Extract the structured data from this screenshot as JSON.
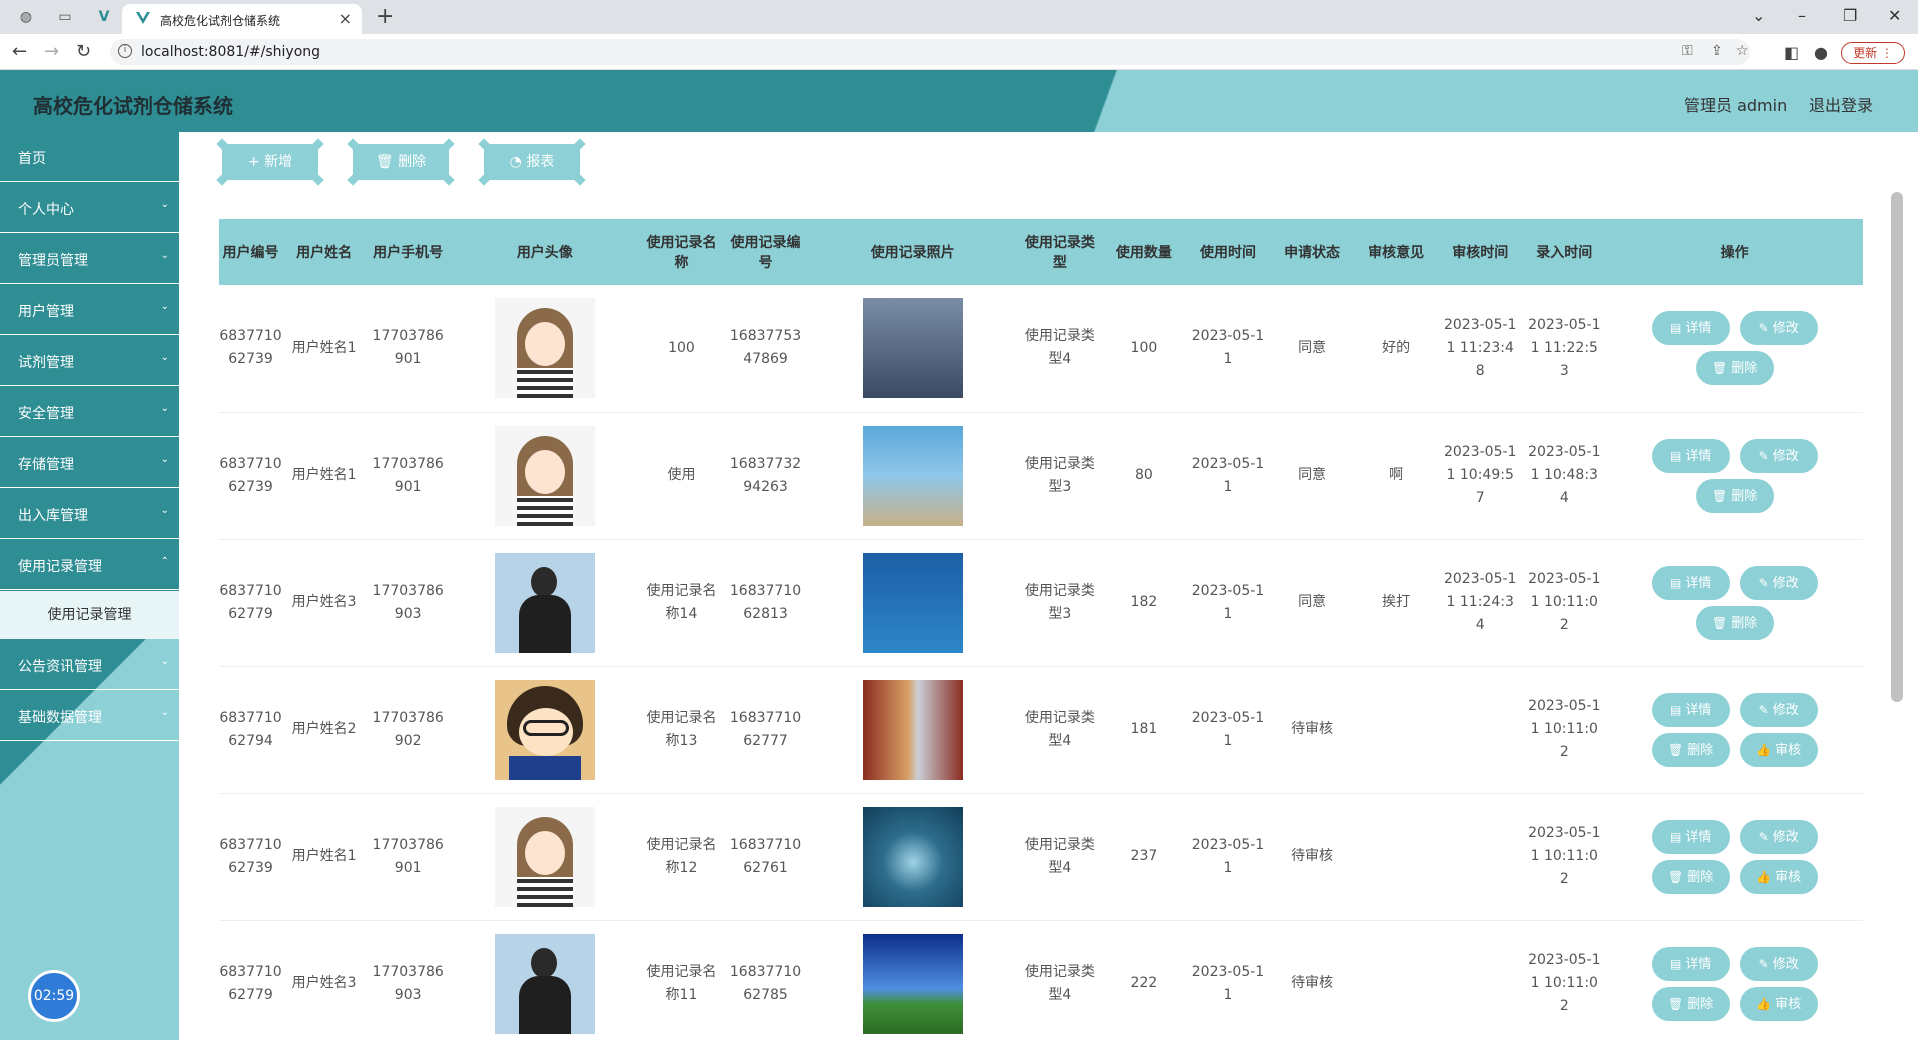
{
  "browser": {
    "tab_title": "高校危化试剂仓储系统",
    "url": "localhost:8081/#/shiyong",
    "update_label": "更新"
  },
  "header": {
    "title": "高校危化试剂仓储系统",
    "user": "管理员 admin",
    "logout": "退出登录"
  },
  "sidebar": {
    "items": [
      {
        "label": "首页"
      },
      {
        "label": "个人中心"
      },
      {
        "label": "管理员管理"
      },
      {
        "label": "用户管理"
      },
      {
        "label": "试剂管理"
      },
      {
        "label": "安全管理"
      },
      {
        "label": "存储管理"
      },
      {
        "label": "出入库管理"
      },
      {
        "label": "使用记录管理"
      },
      {
        "label": "公告资讯管理"
      },
      {
        "label": "基础数据管理"
      }
    ],
    "sub_item": "使用记录管理",
    "timer": "02:59"
  },
  "toolbar": {
    "add": "新增",
    "delete": "删除",
    "report": "报表"
  },
  "table": {
    "headers": [
      "用户编号",
      "用户姓名",
      "用户手机号",
      "用户头像",
      "使用记录名称",
      "使用记录编号",
      "使用记录照片",
      "使用记录类型",
      "使用数量",
      "使用时间",
      "申请状态",
      "审核意见",
      "审核时间",
      "录入时间",
      "操作"
    ],
    "op_labels": {
      "detail": "详情",
      "edit": "修改",
      "delete": "删除",
      "review": "审核"
    },
    "rows": [
      {
        "user_no": "683771062739",
        "user_name": "用户姓名1",
        "phone": "17703786901",
        "name": "100",
        "no": "1683775347869",
        "type": "使用记录类型4",
        "qty": "100",
        "use_time": "2023-05-11",
        "status": "同意",
        "opinion": "好的",
        "review_time": "2023-05-11 11:23:48",
        "entry_time": "2023-05-11 11:22:53"
      },
      {
        "user_no": "683771062739",
        "user_name": "用户姓名1",
        "phone": "17703786901",
        "name": "使用",
        "no": "1683773294263",
        "type": "使用记录类型3",
        "qty": "80",
        "use_time": "2023-05-11",
        "status": "同意",
        "opinion": "啊",
        "review_time": "2023-05-11 10:49:57",
        "entry_time": "2023-05-11 10:48:34"
      },
      {
        "user_no": "683771062779",
        "user_name": "用户姓名3",
        "phone": "17703786903",
        "name": "使用记录名称14",
        "no": "1683771062813",
        "type": "使用记录类型3",
        "qty": "182",
        "use_time": "2023-05-11",
        "status": "同意",
        "opinion": "挨打",
        "review_time": "2023-05-11 11:24:34",
        "entry_time": "2023-05-11 10:11:02"
      },
      {
        "user_no": "683771062794",
        "user_name": "用户姓名2",
        "phone": "17703786902",
        "name": "使用记录名称13",
        "no": "1683771062777",
        "type": "使用记录类型4",
        "qty": "181",
        "use_time": "2023-05-11",
        "status": "待审核",
        "opinion": "",
        "review_time": "",
        "entry_time": "2023-05-11 10:11:02"
      },
      {
        "user_no": "683771062739",
        "user_name": "用户姓名1",
        "phone": "17703786901",
        "name": "使用记录名称12",
        "no": "1683771062761",
        "type": "使用记录类型4",
        "qty": "237",
        "use_time": "2023-05-11",
        "status": "待审核",
        "opinion": "",
        "review_time": "",
        "entry_time": "2023-05-11 10:11:02"
      },
      {
        "user_no": "683771062779",
        "user_name": "用户姓名3",
        "phone": "17703786903",
        "name": "使用记录名称11",
        "no": "1683771062785",
        "type": "使用记录类型4",
        "qty": "222",
        "use_time": "2023-05-11",
        "status": "待审核",
        "opinion": "",
        "review_time": "",
        "entry_time": "2023-05-11 10:11:02"
      }
    ]
  },
  "colors": {
    "primary": "#2e8e94",
    "accent": "#8dd0d6",
    "timer": "#2f7cd8"
  }
}
